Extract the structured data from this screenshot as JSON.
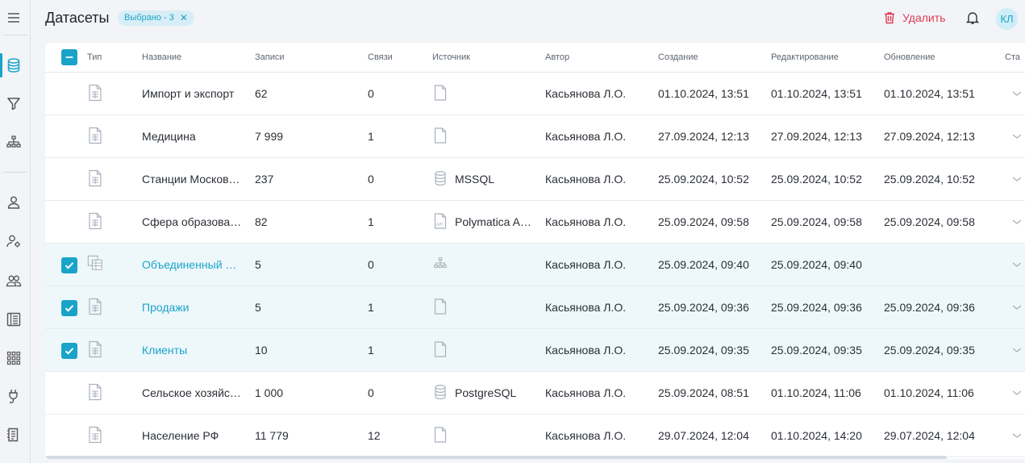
{
  "app": {
    "title": "Датасеты",
    "selected_chip": "Выбрано - 3",
    "delete_label": "Удалить",
    "avatar_initials": "КЛ",
    "accent_color": "#1aa3c9",
    "danger_color": "#e23a54"
  },
  "sidebar": {
    "icons": [
      "menu-icon",
      "database-icon",
      "filter-icon",
      "hierarchy-icon",
      "user-icon",
      "user-settings-icon",
      "users-group-icon",
      "list-book-icon",
      "grid-apps-icon",
      "plug-icon",
      "document-list-icon"
    ]
  },
  "table": {
    "columns": {
      "type": "Тип",
      "name": "Название",
      "records": "Записи",
      "links": "Связи",
      "source": "Источник",
      "author": "Автор",
      "created": "Создание",
      "edited": "Редактирование",
      "updated": "Обновление",
      "status": "Ста"
    },
    "rows": [
      {
        "selected": false,
        "type_icon": "file-table-icon",
        "name": "Импорт и экспорт",
        "records": "62",
        "links": "0",
        "source_icon": "file-icon",
        "source": "",
        "author": "Касьянова Л.О.",
        "created": "01.10.2024, 13:51",
        "edited": "01.10.2024, 13:51",
        "updated": "01.10.2024, 13:51"
      },
      {
        "selected": false,
        "type_icon": "file-table-icon",
        "name": "Медицина",
        "records": "7 999",
        "links": "1",
        "source_icon": "file-icon",
        "source": "",
        "author": "Касьянова Л.О.",
        "created": "27.09.2024, 12:13",
        "edited": "27.09.2024, 12:13",
        "updated": "27.09.2024, 12:13"
      },
      {
        "selected": false,
        "type_icon": "file-table-icon",
        "name": "Станции Москов…",
        "records": "237",
        "links": "0",
        "source_icon": "database-icon",
        "source": "MSSQL",
        "author": "Касьянова Л.О.",
        "created": "25.09.2024, 10:52",
        "edited": "25.09.2024, 10:52",
        "updated": "25.09.2024, 10:52"
      },
      {
        "selected": false,
        "type_icon": "file-table-icon",
        "name": "Сфера образова…",
        "records": "82",
        "links": "1",
        "source_icon": "api-file-icon",
        "source": "Polymatica A…",
        "author": "Касьянова Л.О.",
        "created": "25.09.2024, 09:58",
        "edited": "25.09.2024, 09:58",
        "updated": "25.09.2024, 09:58"
      },
      {
        "selected": true,
        "type_icon": "merged-table-icon",
        "name": "Объединенный …",
        "records": "5",
        "links": "0",
        "source_icon": "hierarchy-icon",
        "source": "",
        "author": "Касьянова Л.О.",
        "created": "25.09.2024, 09:40",
        "edited": "25.09.2024, 09:40",
        "updated": ""
      },
      {
        "selected": true,
        "type_icon": "file-table-icon",
        "name": "Продажи",
        "records": "5",
        "links": "1",
        "source_icon": "file-icon",
        "source": "",
        "author": "Касьянова Л.О.",
        "created": "25.09.2024, 09:36",
        "edited": "25.09.2024, 09:36",
        "updated": "25.09.2024, 09:36"
      },
      {
        "selected": true,
        "type_icon": "file-table-icon",
        "name": "Клиенты",
        "records": "10",
        "links": "1",
        "source_icon": "file-icon",
        "source": "",
        "author": "Касьянова Л.О.",
        "created": "25.09.2024, 09:35",
        "edited": "25.09.2024, 09:35",
        "updated": "25.09.2024, 09:35"
      },
      {
        "selected": false,
        "type_icon": "file-table-icon",
        "name": "Сельское хозяйс…",
        "records": "1 000",
        "links": "0",
        "source_icon": "database-icon",
        "source": "PostgreSQL",
        "author": "Касьянова Л.О.",
        "created": "25.09.2024, 08:51",
        "edited": "01.10.2024, 11:06",
        "updated": "01.10.2024, 11:06"
      },
      {
        "selected": false,
        "type_icon": "file-table-icon",
        "name": "Население РФ",
        "records": "11 779",
        "links": "12",
        "source_icon": "file-icon",
        "source": "",
        "author": "Касьянова Л.О.",
        "created": "29.07.2024, 12:04",
        "edited": "01.10.2024, 14:20",
        "updated": "29.07.2024, 12:04"
      }
    ]
  }
}
